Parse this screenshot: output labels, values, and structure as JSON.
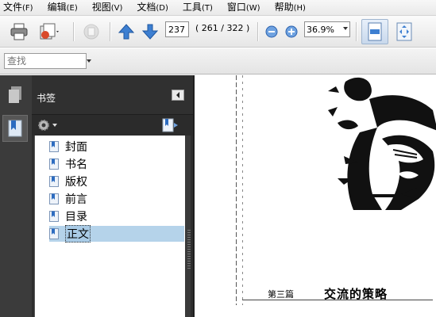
{
  "menubar": {
    "items": [
      {
        "label": "文件",
        "accel": "(F)"
      },
      {
        "label": "编辑",
        "accel": "(E)"
      },
      {
        "label": "视图",
        "accel": "(V)"
      },
      {
        "label": "文档",
        "accel": "(D)"
      },
      {
        "label": "工具",
        "accel": "(T)"
      },
      {
        "label": "窗口",
        "accel": "(W)"
      },
      {
        "label": "帮助",
        "accel": "(H)"
      }
    ]
  },
  "toolbar": {
    "icons": [
      "print-icon",
      "share-icon",
      "pages-icon",
      "previous-page-icon",
      "next-page-icon",
      "zoom-out-icon",
      "zoom-in-icon",
      "fit-width-icon",
      "fit-page-icon"
    ],
    "current_page": "237",
    "page_total": "( 261 / 322 )",
    "zoom": "36.9%"
  },
  "find": {
    "placeholder": "查找"
  },
  "bookmarks_panel": {
    "title": "书签",
    "items": [
      {
        "label": "封面",
        "selected": false
      },
      {
        "label": "书名",
        "selected": false
      },
      {
        "label": "版权",
        "selected": false
      },
      {
        "label": "前言",
        "selected": false
      },
      {
        "label": "目录",
        "selected": false
      },
      {
        "label": "正文",
        "selected": true
      }
    ]
  },
  "document": {
    "chapter_label": "第三篇",
    "chapter_title": "交流的策略"
  },
  "colors": {
    "panel_bg": "#2e2e2e",
    "selection": "#b5d3ea",
    "arrow_blue": "#3d7fd1"
  }
}
